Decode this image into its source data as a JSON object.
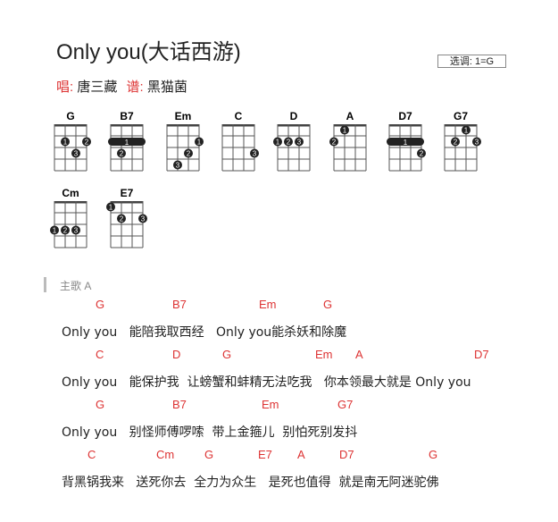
{
  "title": "Only you(大话西游)",
  "key": "选调: 1=G",
  "credits": {
    "singer_label": "唱:",
    "singer": "唐三藏",
    "score_label": "谱:",
    "score": "黑猫菌"
  },
  "chords": [
    {
      "name": "G"
    },
    {
      "name": "B7"
    },
    {
      "name": "Em"
    },
    {
      "name": "C"
    },
    {
      "name": "D"
    },
    {
      "name": "A"
    },
    {
      "name": "D7"
    },
    {
      "name": "G7"
    },
    {
      "name": "Cm"
    },
    {
      "name": "E7"
    }
  ],
  "section": "主歌 A",
  "lines": [
    {
      "chords": [
        "G",
        "B7",
        "Em",
        "G"
      ],
      "lyric": "Only you   能陪我取西经   Only you能杀妖和除魔"
    },
    {
      "chords": [
        "C",
        "D",
        "G",
        "Em",
        "A",
        "D7"
      ],
      "lyric": "Only you   能保护我  让螃蟹和蚌精无法吃我   你本领最大就是 Only you"
    },
    {
      "chords": [
        "G",
        "B7",
        "Em",
        "G7"
      ],
      "lyric": "Only you   别怪师傅啰嗦  带上金箍儿  别怕死别发抖"
    },
    {
      "chords": [
        "C",
        "Cm",
        "G",
        "E7",
        "A",
        "D7",
        "G"
      ],
      "lyric": "背黑锅我来   送死你去  全力为众生   是死也值得  就是南无阿迷驼佛"
    }
  ]
}
